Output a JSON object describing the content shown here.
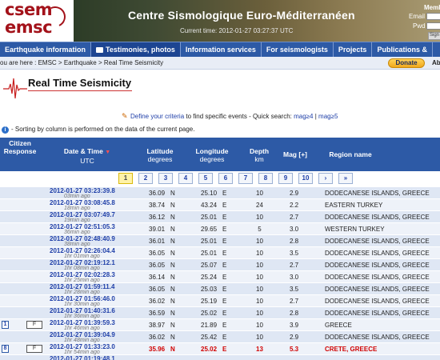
{
  "header": {
    "logo_line1": "csem",
    "logo_line2": "emsc",
    "title": "Centre Sismologique Euro-Méditerranéen",
    "current_time": "Current time: 2012-01-27 03:27:37 UTC",
    "member_label": "Member",
    "email_label": "Email",
    "pwd_label": "Pwd",
    "signin_label": "Sign"
  },
  "nav": {
    "items": [
      {
        "label": "Earthquake information"
      },
      {
        "label": "Testimonies, photos"
      },
      {
        "label": "Information services"
      },
      {
        "label": "For seismologists"
      },
      {
        "label": "Projects"
      },
      {
        "label": "Publications &"
      }
    ]
  },
  "breadcrumb": {
    "text": "ou are here : EMSC > Earthquake > Real Time Seismicity",
    "donate_label": "Donate",
    "right_text": "Ab"
  },
  "page": {
    "title": "Real Time Seismicity",
    "define_link": "Define your criteria",
    "define_rest": " to find specific events - Quick search: ",
    "quick1": "mag≥4",
    "quick_sep": " | ",
    "quick2": "mag≥5",
    "info": "- Sorting by column is performed on the data of the current page."
  },
  "table": {
    "headers": {
      "citizen": "Citizen Response",
      "datetime": "Date & Time",
      "datetime_sub": "UTC",
      "lat": "Latitude",
      "lat_sub": "degrees",
      "lon": "Longitude",
      "lon_sub": "degrees",
      "depth": "Depth",
      "depth_sub": "km",
      "mag": "Mag [+]",
      "region": "Region name"
    },
    "pages": [
      "1",
      "2",
      "3",
      "4",
      "5",
      "6",
      "7",
      "8",
      "9",
      "10",
      "›",
      "»"
    ],
    "rows": [
      {
        "dt": "2012-01-27   03:23:39.8",
        "ago": "03min ago",
        "lat": "36.09",
        "latd": "N",
        "lon": "25.10",
        "lond": "E",
        "depth": "10",
        "mag": "2.9",
        "region": "DODECANESE ISLANDS, GREECE"
      },
      {
        "dt": "2012-01-27   03:08:45.8",
        "ago": "18min ago",
        "lat": "38.74",
        "latd": "N",
        "lon": "43.24",
        "lond": "E",
        "depth": "24",
        "mag": "2.2",
        "region": "EASTERN TURKEY"
      },
      {
        "dt": "2012-01-27   03:07:49.7",
        "ago": "19min ago",
        "lat": "36.12",
        "latd": "N",
        "lon": "25.01",
        "lond": "E",
        "depth": "10",
        "mag": "2.7",
        "region": "DODECANESE ISLANDS, GREECE"
      },
      {
        "dt": "2012-01-27   02:51:05.3",
        "ago": "36min ago",
        "lat": "39.01",
        "latd": "N",
        "lon": "29.65",
        "lond": "E",
        "depth": "5",
        "mag": "3.0",
        "region": "WESTERN TURKEY"
      },
      {
        "dt": "2012-01-27   02:48:40.9",
        "ago": "38min ago",
        "lat": "36.01",
        "latd": "N",
        "lon": "25.01",
        "lond": "E",
        "depth": "10",
        "mag": "2.8",
        "region": "DODECANESE ISLANDS, GREECE"
      },
      {
        "dt": "2012-01-27   02:26:04.4",
        "ago": "1hr 01min ago",
        "lat": "36.05",
        "latd": "N",
        "lon": "25.01",
        "lond": "E",
        "depth": "10",
        "mag": "3.5",
        "region": "DODECANESE ISLANDS, GREECE"
      },
      {
        "dt": "2012-01-27   02:19:12.1",
        "ago": "1hr 08min ago",
        "lat": "36.05",
        "latd": "N",
        "lon": "25.07",
        "lond": "E",
        "depth": "10",
        "mag": "2.7",
        "region": "DODECANESE ISLANDS, GREECE"
      },
      {
        "dt": "2012-01-27   02:02:28.3",
        "ago": "1hr 25min ago",
        "lat": "36.14",
        "latd": "N",
        "lon": "25.24",
        "lond": "E",
        "depth": "10",
        "mag": "3.0",
        "region": "DODECANESE ISLANDS, GREECE"
      },
      {
        "dt": "2012-01-27   01:59:11.4",
        "ago": "1hr 28min ago",
        "lat": "36.05",
        "latd": "N",
        "lon": "25.03",
        "lond": "E",
        "depth": "10",
        "mag": "3.5",
        "region": "DODECANESE ISLANDS, GREECE"
      },
      {
        "dt": "2012-01-27   01:56:46.0",
        "ago": "1hr 30min ago",
        "lat": "36.02",
        "latd": "N",
        "lon": "25.19",
        "lond": "E",
        "depth": "10",
        "mag": "2.7",
        "region": "DODECANESE ISLANDS, GREECE"
      },
      {
        "dt": "2012-01-27   01:40:31.6",
        "ago": "1hr 36min ago",
        "lat": "36.59",
        "latd": "N",
        "lon": "25.02",
        "lond": "E",
        "depth": "10",
        "mag": "2.8",
        "region": "DODECANESE ISLANDS, GREECE"
      },
      {
        "dt": "2012-01-27   01:39:59.3",
        "ago": "1hr 46min ago",
        "lat": "38.97",
        "latd": "N",
        "lon": "21.89",
        "lond": "E",
        "depth": "10",
        "mag": "3.9",
        "region": "GREECE",
        "badge": "1",
        "fbtn": "F"
      },
      {
        "dt": "2012-01-27   01:39:04.9",
        "ago": "1hr 48min ago",
        "lat": "36.02",
        "latd": "N",
        "lon": "25.42",
        "lond": "E",
        "depth": "10",
        "mag": "2.9",
        "region": "DODECANESE ISLANDS, GREECE"
      },
      {
        "dt": "2012-01-27   01:33:23.0",
        "ago": "1hr 54min ago",
        "lat": "35.96",
        "latd": "N",
        "lon": "25.02",
        "lond": "E",
        "depth": "13",
        "mag": "5.3",
        "region": "CRETE, GREECE",
        "badge": "8",
        "fbtn": "F",
        "highlight": true
      },
      {
        "dt": "2012-01-27   01:19:48.1",
        "ago": "",
        "lat": "",
        "latd": "",
        "lon": "",
        "lond": "",
        "depth": "",
        "mag": "",
        "region": ""
      }
    ]
  }
}
